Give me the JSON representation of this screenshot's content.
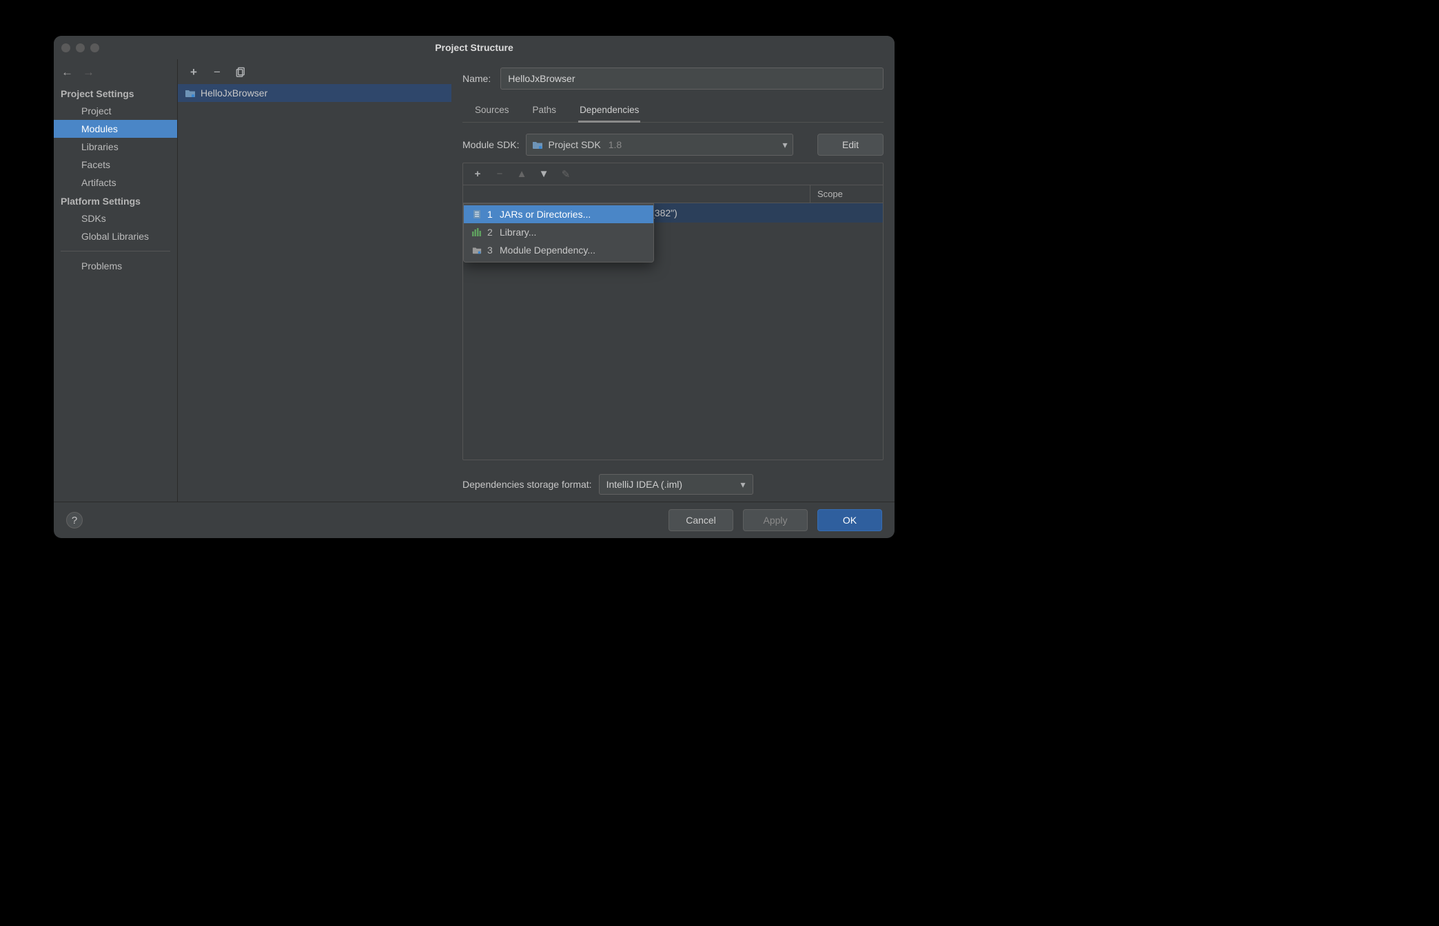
{
  "title": "Project Structure",
  "nav": {
    "back_enabled": true,
    "forward_enabled": false,
    "sections": [
      {
        "heading": "Project Settings",
        "items": [
          "Project",
          "Modules",
          "Libraries",
          "Facets",
          "Artifacts"
        ],
        "selected": "Modules"
      },
      {
        "heading": "Platform Settings",
        "items": [
          "SDKs",
          "Global Libraries"
        ]
      }
    ],
    "problems_label": "Problems"
  },
  "modules": {
    "items": [
      {
        "name": "HelloJxBrowser",
        "selected": true
      }
    ]
  },
  "detail": {
    "name_label": "Name:",
    "name_value": "HelloJxBrowser",
    "tabs": [
      "Sources",
      "Paths",
      "Dependencies"
    ],
    "active_tab": "Dependencies",
    "sdk_label": "Module SDK:",
    "sdk_value": "Project SDK",
    "sdk_version": "1.8",
    "edit_label": "Edit",
    "deps_header_scope": "Scope",
    "dep_row_fragment": "_382\")",
    "add_menu": [
      {
        "n": "1",
        "label": "JARs or Directories...",
        "selected": true,
        "icon": "jar"
      },
      {
        "n": "2",
        "label": "Library...",
        "icon": "library"
      },
      {
        "n": "3",
        "label": "Module Dependency...",
        "icon": "module"
      }
    ],
    "storage_label": "Dependencies storage format:",
    "storage_value": "IntelliJ IDEA (.iml)"
  },
  "footer": {
    "cancel": "Cancel",
    "apply": "Apply",
    "ok": "OK"
  }
}
